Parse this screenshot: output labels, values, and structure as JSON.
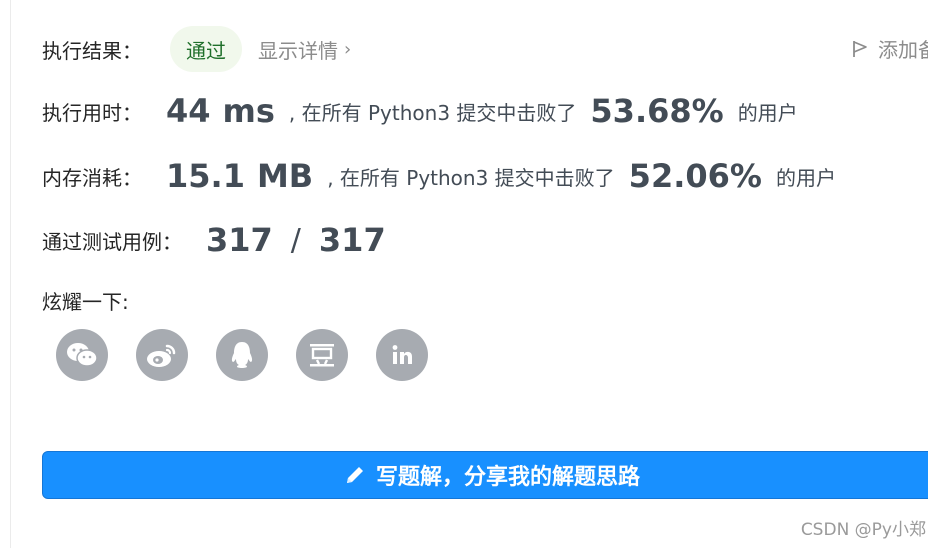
{
  "result": {
    "label": "执行结果：",
    "status": "通过",
    "details_link": "显示详情",
    "add_note": "添加备"
  },
  "runtime": {
    "label": "执行用时：",
    "value": "44",
    "unit": "ms",
    "mid_text": ", 在所有 Python3 提交中击败了",
    "percent": "53.68%",
    "suffix": "的用户"
  },
  "memory": {
    "label": "内存消耗：",
    "value": "15.1",
    "unit": "MB",
    "mid_text": ", 在所有 Python3 提交中击败了",
    "percent": "52.06%",
    "suffix": "的用户"
  },
  "tests": {
    "label": "通过测试用例：",
    "passed": "317",
    "separator": "/",
    "total": "317"
  },
  "share": {
    "label": "炫耀一下:",
    "icons": [
      "wechat-icon",
      "weibo-icon",
      "qq-icon",
      "douban-icon",
      "linkedin-icon"
    ]
  },
  "cta": {
    "label": "写题解，分享我的解题思路"
  },
  "watermark": "CSDN @Py小郑",
  "colors": {
    "accent": "#1890ff",
    "success_bg": "#f1f8ec",
    "success_text": "#1f6f2a",
    "icon_gray": "#a7abb1",
    "value_text": "#434c56"
  }
}
